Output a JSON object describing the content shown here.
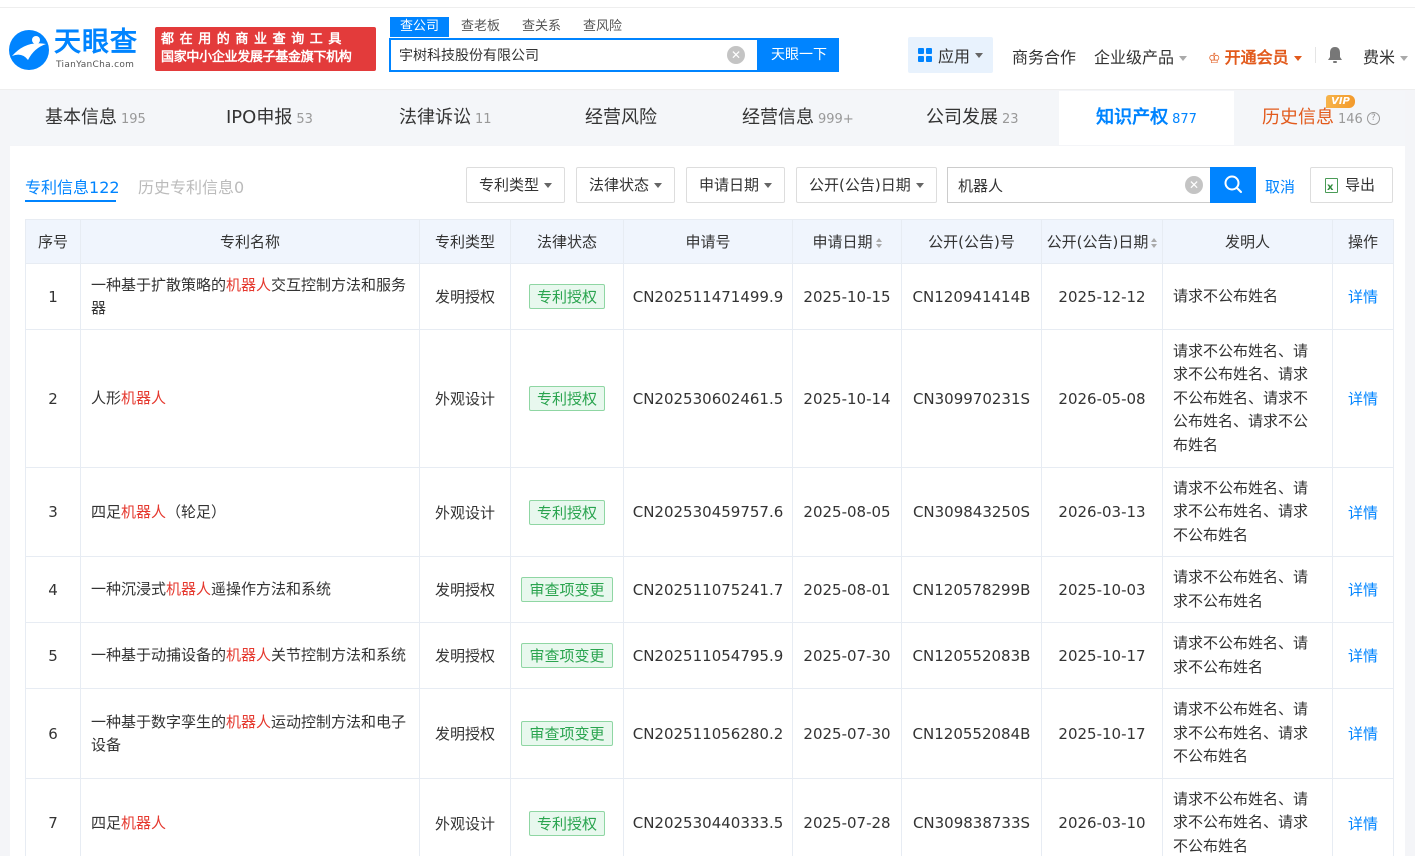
{
  "brand": {
    "name": "天眼查",
    "domain": "TianYanCha.com",
    "slogan_line1": "都在用的商业查询工具",
    "slogan_line2": "国家中小企业发展子基金旗下机构",
    "accent": "#0084ff",
    "slogan_bg": "#e33b3b"
  },
  "search": {
    "tabs": [
      "查公司",
      "查老板",
      "查关系",
      "查风险"
    ],
    "value": "宇树科技股份有限公司",
    "button": "天眼一下"
  },
  "nav": {
    "apps": "应用",
    "business": "商务合作",
    "enterprise": "企业级产品",
    "vip": "开通会员",
    "user": "费米"
  },
  "main_tabs": [
    {
      "label": "基本信息",
      "count": "195"
    },
    {
      "label": "IPO申报",
      "count": "53"
    },
    {
      "label": "法律诉讼",
      "count": "11"
    },
    {
      "label": "经营风险",
      "count": ""
    },
    {
      "label": "经营信息",
      "count": "999+"
    },
    {
      "label": "公司发展",
      "count": "23"
    },
    {
      "label": "知识产权",
      "count": "877"
    },
    {
      "label": "历史信息",
      "count": "146"
    }
  ],
  "vip_badge": "VIP",
  "sub_tabs": {
    "current": "专利信息",
    "current_count": "122",
    "history": "历史专利信息",
    "history_count": "0"
  },
  "filters": {
    "type": "专利类型",
    "status": "法律状态",
    "apply_date": "申请日期",
    "pub_date": "公开(公告)日期",
    "keyword": "机器人",
    "cancel": "取消",
    "export": "导出"
  },
  "table": {
    "headers": [
      "序号",
      "专利名称",
      "专利类型",
      "法律状态",
      "申请号",
      "申请日期",
      "公开(公告)号",
      "公开(公告)日期",
      "发明人",
      "操作"
    ],
    "detail_label": "详情",
    "rows": [
      {
        "no": "1",
        "name_pre": "一种基于扩散策略的",
        "name_hl": "机器人",
        "name_post": "交互控制方法和服务器",
        "type": "发明授权",
        "status": "专利授权",
        "app_no": "CN202511471499.9",
        "app_date": "2025-10-15",
        "pub_no": "CN120941414B",
        "pub_date": "2025-12-12",
        "inventor": "请求不公布姓名"
      },
      {
        "no": "2",
        "name_pre": "人形",
        "name_hl": "机器人",
        "name_post": "",
        "type": "外观设计",
        "status": "专利授权",
        "app_no": "CN202530602461.5",
        "app_date": "2025-10-14",
        "pub_no": "CN309970231S",
        "pub_date": "2026-05-08",
        "inventor": "请求不公布姓名、请求不公布姓名、请求不公布姓名、请求不公布姓名、请求不公布姓名"
      },
      {
        "no": "3",
        "name_pre": "四足",
        "name_hl": "机器人",
        "name_post": "（轮足）",
        "type": "外观设计",
        "status": "专利授权",
        "app_no": "CN202530459757.6",
        "app_date": "2025-08-05",
        "pub_no": "CN309843250S",
        "pub_date": "2026-03-13",
        "inventor": "请求不公布姓名、请求不公布姓名、请求不公布姓名"
      },
      {
        "no": "4",
        "name_pre": "一种沉浸式",
        "name_hl": "机器人",
        "name_post": "遥操作方法和系统",
        "type": "发明授权",
        "status": "审查项变更",
        "app_no": "CN202511075241.7",
        "app_date": "2025-08-01",
        "pub_no": "CN120578299B",
        "pub_date": "2025-10-03",
        "inventor": "请求不公布姓名、请求不公布姓名"
      },
      {
        "no": "5",
        "name_pre": "一种基于动捕设备的",
        "name_hl": "机器人",
        "name_post": "关节控制方法和系统",
        "type": "发明授权",
        "status": "审查项变更",
        "app_no": "CN202511054795.9",
        "app_date": "2025-07-30",
        "pub_no": "CN120552083B",
        "pub_date": "2025-10-17",
        "inventor": "请求不公布姓名、请求不公布姓名"
      },
      {
        "no": "6",
        "name_pre": "一种基于数字孪生的",
        "name_hl": "机器人",
        "name_post": "运动控制方法和电子设备",
        "type": "发明授权",
        "status": "审查项变更",
        "app_no": "CN202511056280.2",
        "app_date": "2025-07-30",
        "pub_no": "CN120552084B",
        "pub_date": "2025-10-17",
        "inventor": "请求不公布姓名、请求不公布姓名、请求不公布姓名"
      },
      {
        "no": "7",
        "name_pre": "四足",
        "name_hl": "机器人",
        "name_post": "",
        "type": "外观设计",
        "status": "专利授权",
        "app_no": "CN202530440333.5",
        "app_date": "2025-07-28",
        "pub_no": "CN309838733S",
        "pub_date": "2026-03-10",
        "inventor": "请求不公布姓名、请求不公布姓名、请求不公布姓名"
      }
    ]
  }
}
